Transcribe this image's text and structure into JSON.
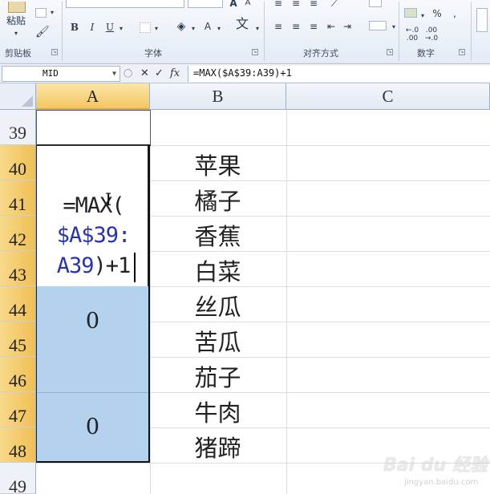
{
  "ribbon": {
    "paste_label": "粘贴",
    "clipboard_group": "剪贴板",
    "font_group": "字体",
    "alignment_group": "对齐方式",
    "number_group": "数字",
    "bold": "B",
    "italic": "I",
    "underline": "U",
    "font_color_glyph": "A",
    "grow_font": "A",
    "shrink_font": "A",
    "phonetic": "文",
    "percent": "%",
    "comma": ","
  },
  "formula_bar": {
    "name_box": "MID",
    "cancel_glyph": "✕",
    "enter_glyph": "✓",
    "fx_label": "fx",
    "formula": "=MAX($A$39:A39)+1"
  },
  "columns": [
    "A",
    "B",
    "C"
  ],
  "active_column": "A",
  "rows": [
    "39",
    "40",
    "41",
    "42",
    "43",
    "44",
    "45",
    "46",
    "47",
    "48",
    "49"
  ],
  "editing_cell": {
    "line1": "=MAX(",
    "line2": "$A$39:",
    "line3_ref": "A39",
    "line3_rest": ")+1"
  },
  "merged_values": [
    "0",
    "0"
  ],
  "column_b": [
    "苹果",
    "橘子",
    "香蕉",
    "白菜",
    "丝瓜",
    "苦瓜",
    "茄子",
    "牛肉",
    "猪蹄"
  ],
  "watermark": {
    "brand": "Bai du 经验",
    "url": "jingyan.baidu.com"
  },
  "colors": {
    "selection": "#b4d1ee",
    "active_header": "#f3c75f",
    "ref_text": "#2432b8"
  }
}
